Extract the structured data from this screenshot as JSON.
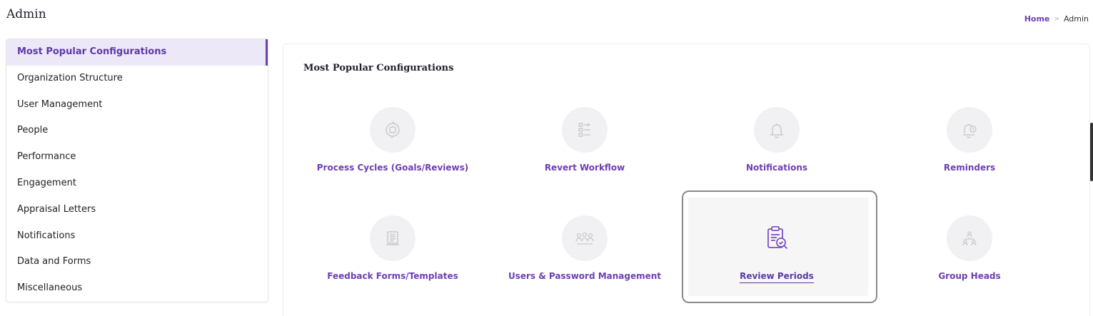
{
  "page": {
    "title": "Admin"
  },
  "breadcrumb": {
    "home": "Home",
    "separator": ">",
    "current": "Admin"
  },
  "sidebar": {
    "items": [
      {
        "label": "Most Popular Configurations",
        "active": true
      },
      {
        "label": "Organization Structure"
      },
      {
        "label": "User Management"
      },
      {
        "label": "People"
      },
      {
        "label": "Performance"
      },
      {
        "label": "Engagement"
      },
      {
        "label": "Appraisal Letters"
      },
      {
        "label": "Notifications"
      },
      {
        "label": "Data and Forms"
      },
      {
        "label": "Miscellaneous"
      }
    ]
  },
  "panel": {
    "title": "Most Popular Configurations",
    "tiles": [
      {
        "label": "Process Cycles (Goals/Reviews)",
        "icon": "process-cycle-icon"
      },
      {
        "label": "Revert Workflow",
        "icon": "workflow-icon"
      },
      {
        "label": "Notifications",
        "icon": "bell-icon"
      },
      {
        "label": "Reminders",
        "icon": "bell-clock-icon"
      },
      {
        "label": "Feedback Forms/Templates",
        "icon": "form-template-icon"
      },
      {
        "label": "Users & Password Management",
        "icon": "users-icon"
      },
      {
        "label": "Review Periods",
        "icon": "clipboard-search-icon",
        "selected": true
      },
      {
        "label": "Group Heads",
        "icon": "hierarchy-icon"
      }
    ]
  },
  "colors": {
    "accent": "#6c3fb5",
    "active_bg": "#ede8f8",
    "icon_bg": "#f1f1f3",
    "icon_stroke": "#c9c9ce",
    "selected_icon": "#7b4fc4"
  }
}
